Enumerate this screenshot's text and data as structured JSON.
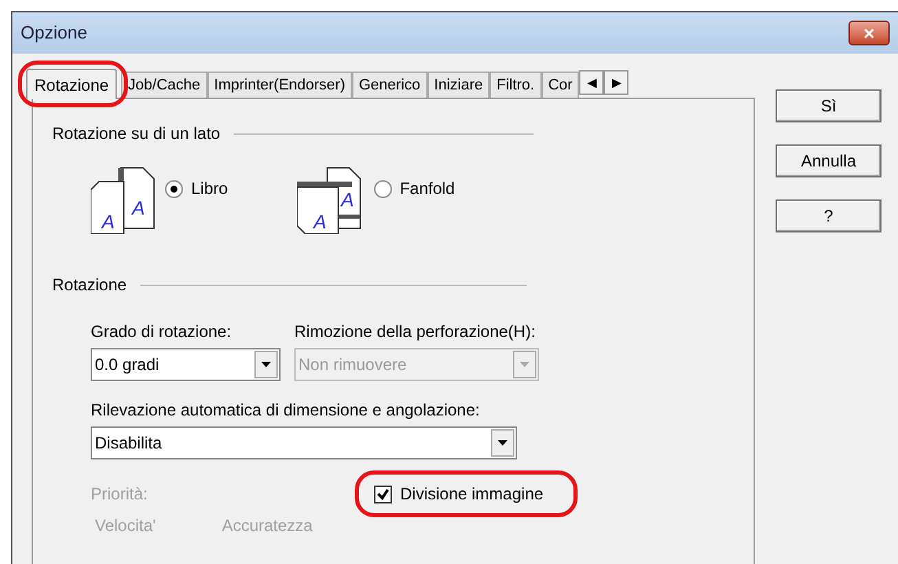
{
  "window": {
    "title": "Opzione",
    "close": "×"
  },
  "tabs": [
    {
      "label": "Rotazione",
      "selected": true,
      "highlighted": true
    },
    {
      "label": "Job/Cache",
      "selected": false,
      "highlighted": false
    },
    {
      "label": "Imprinter(Endorser)",
      "selected": false,
      "highlighted": false
    },
    {
      "label": "Generico",
      "selected": false,
      "highlighted": false
    },
    {
      "label": "Iniziare",
      "selected": false,
      "highlighted": false
    },
    {
      "label": "Filtro.",
      "selected": false,
      "highlighted": false
    },
    {
      "label": "Cor",
      "selected": false,
      "highlighted": false
    }
  ],
  "tab_scroll": [
    "◀",
    "▶"
  ],
  "side_group": {
    "title": "Rotazione su di un lato",
    "options": [
      {
        "label": "Libro",
        "kind": "book",
        "selected": true,
        "icon_letters": [
          "A",
          "A"
        ]
      },
      {
        "label": "Fanfold",
        "kind": "fanfold",
        "selected": false,
        "icon_letters": [
          "A",
          "A"
        ]
      }
    ]
  },
  "rotation_group": {
    "title": "Rotazione",
    "selects": [
      {
        "label": "Grado di rotazione:",
        "value": "0.0 gradi",
        "disabled": false
      },
      {
        "label": "Rimozione della perforazione(H):",
        "value": "Non rimuovere",
        "disabled": true
      }
    ],
    "auto_detect": {
      "label": "Rilevazione automatica di dimensione e angolazione:",
      "value": "Disabilita",
      "disabled": false
    },
    "priority": {
      "label": "Priorità:",
      "disabled": true,
      "ends": [
        "Velocita'",
        "Accuratezza"
      ]
    },
    "split_image": {
      "label": "Divisione immagine",
      "checked": true,
      "highlighted": true
    }
  },
  "buttons": [
    "Sì",
    "Annulla",
    "?"
  ]
}
